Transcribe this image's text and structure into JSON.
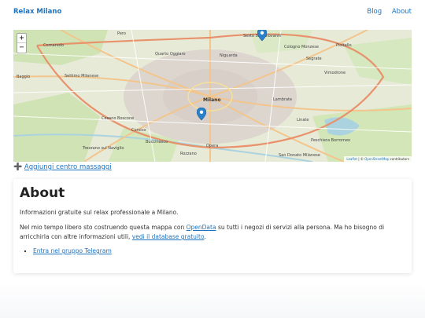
{
  "navbar": {
    "brand": "Relax Milano",
    "links": [
      "Blog",
      "About"
    ]
  },
  "map": {
    "zoom_in": "+",
    "zoom_out": "−",
    "attribution_leaflet": "Leaflet",
    "attribution_sep": " | © ",
    "attribution_osm": "OpenStreetMap",
    "attribution_tail": " contributors",
    "labels": [
      "Pero",
      "Cornaredo",
      "Settimo Milanese",
      "Baggio",
      "Milano",
      "Sesto San Giovanni",
      "Cologno Monzese",
      "Segrate",
      "Pioltello",
      "Cesano Boscone",
      "Corsico",
      "Buccinasco",
      "Opera",
      "San Donato Milanese",
      "Peschiera Borromeo",
      "Quarto Oggiaro",
      "Niguarda",
      "Lambrate",
      "Rozzano",
      "Trezzano sul Naviglio",
      "Linate",
      "Vimodrone"
    ],
    "marker_color": "#2a81cb"
  },
  "add_massage": {
    "icon": "➕",
    "label": "Aggiungi centro massaggi"
  },
  "about": {
    "title": "About",
    "intro": "Informazioni gratuite sul relax professionale a Milano.",
    "p2_a": "Nel mio tempo libero sto costruendo questa mappa con ",
    "p2_link1": "OpenData",
    "p2_b": " su tutti i negozi di servizi alla persona. Ma ho bisogno di arricchirla con altre informazioni utili, ",
    "p2_link2": "vedi il database gratuito",
    "p2_c": ".",
    "list": [
      "Entra nel gruppo Telegram"
    ]
  }
}
